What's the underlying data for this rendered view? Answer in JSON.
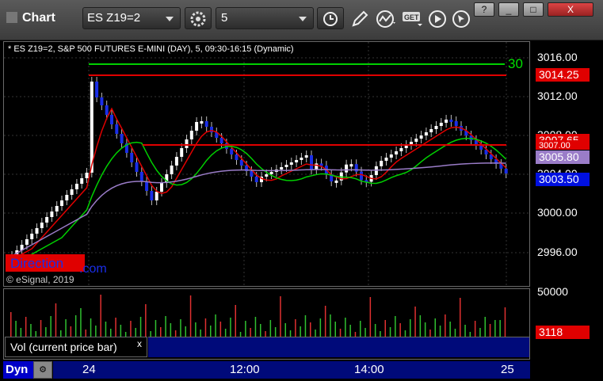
{
  "window": {
    "title": "Chart"
  },
  "toolbar": {
    "symbol": "ES Z19=2",
    "interval": "5",
    "window_buttons": [
      "?",
      "_",
      "□",
      "X"
    ],
    "icons": [
      "gear-icon",
      "clock-icon",
      "pencil-icon",
      "study-icon",
      "get-icon",
      "play-icon",
      "cursor-icon"
    ]
  },
  "price_panel": {
    "caption": "* ES Z19=2, S&P 500 FUTURES E-MINI (DAY), 5, 09:30-16:15 (Dynamic)",
    "watermark": "Direction",
    "watermark2": ".com",
    "copyright": "© eSignal, 2019",
    "green_line_label": "30",
    "axis_labels": [
      "3016.00",
      "3012.00",
      "3008.00",
      "3004.00",
      "3000.00",
      "2996.00"
    ],
    "price_tags": [
      {
        "value": "3014.25",
        "color": "#e00000"
      },
      {
        "value": "3007.65",
        "color": "#e00000"
      },
      {
        "value": "3007.00",
        "color": "#e00000"
      },
      {
        "value": "3005.80",
        "color": "#9a7cc8"
      },
      {
        "value": "3003.50",
        "color": "#0010e0"
      }
    ],
    "colors": {
      "up": "#ffffff",
      "down": "#1a2ee8",
      "green": "#00d000",
      "red": "#e00000",
      "purple": "#9a7cc8"
    }
  },
  "volume_panel": {
    "axis_label": "50000",
    "last_value": "3118",
    "tab_label": "Vol (current price bar)",
    "tab_close": "x"
  },
  "time_axis": {
    "labels": [
      "24",
      "12:00",
      "14:00",
      "25"
    ],
    "dyn_label": "Dyn"
  }
}
